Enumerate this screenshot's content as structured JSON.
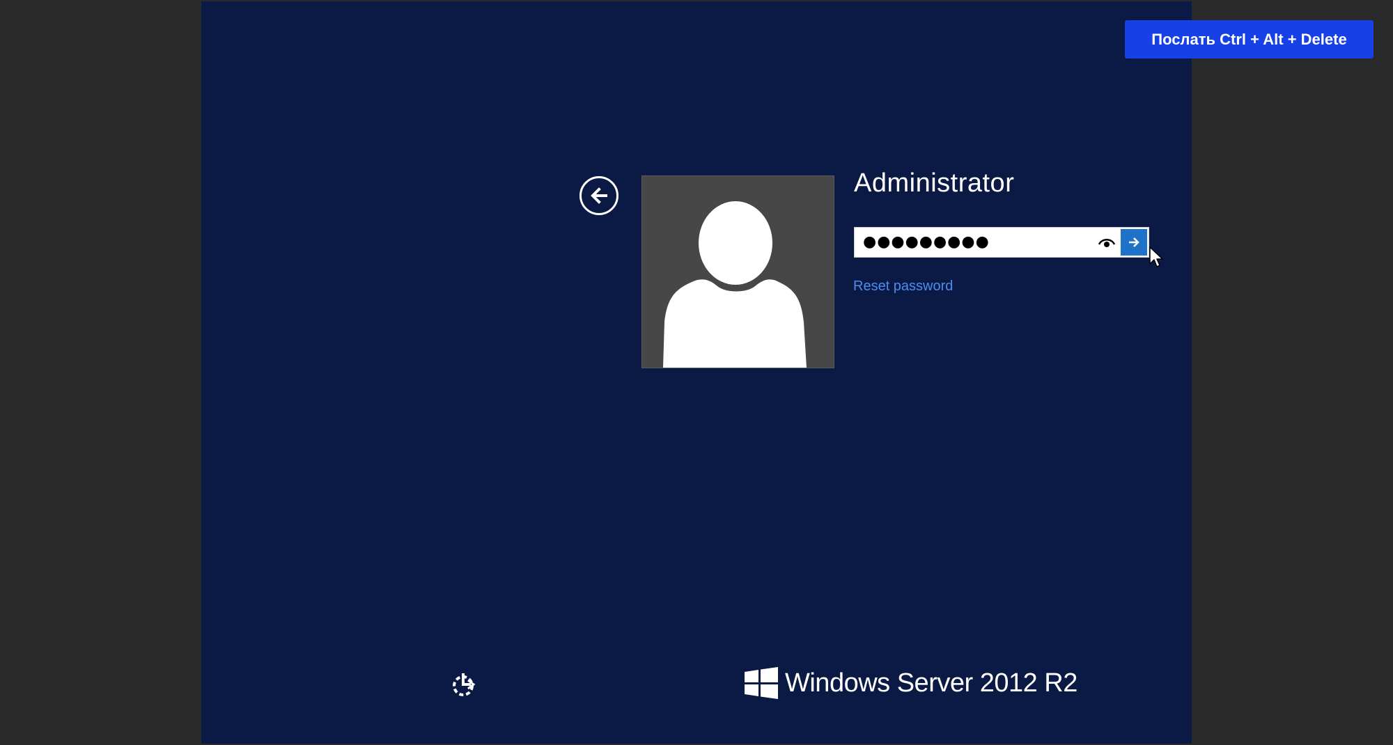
{
  "top_bar": {
    "send_cad_label": "Послать Ctrl + Alt + Delete",
    "accent_color": "#1741e6"
  },
  "login": {
    "username": "Administrator",
    "password_mask": "●●●●●●●●●",
    "reset_password_label": "Reset password",
    "back_icon": "back-arrow-icon",
    "reveal_icon": "eye-icon",
    "submit_icon": "arrow-right-icon",
    "submit_color": "#1e73c8",
    "link_color": "#4a8ef0"
  },
  "footer": {
    "ease_of_access_icon": "ease-of-access-icon",
    "brand_text": "Windows Server 2012 R2"
  },
  "colors": {
    "screen_background": "#0b1a45",
    "outer_background": "#2a2a2a",
    "avatar_background": "#474747"
  }
}
